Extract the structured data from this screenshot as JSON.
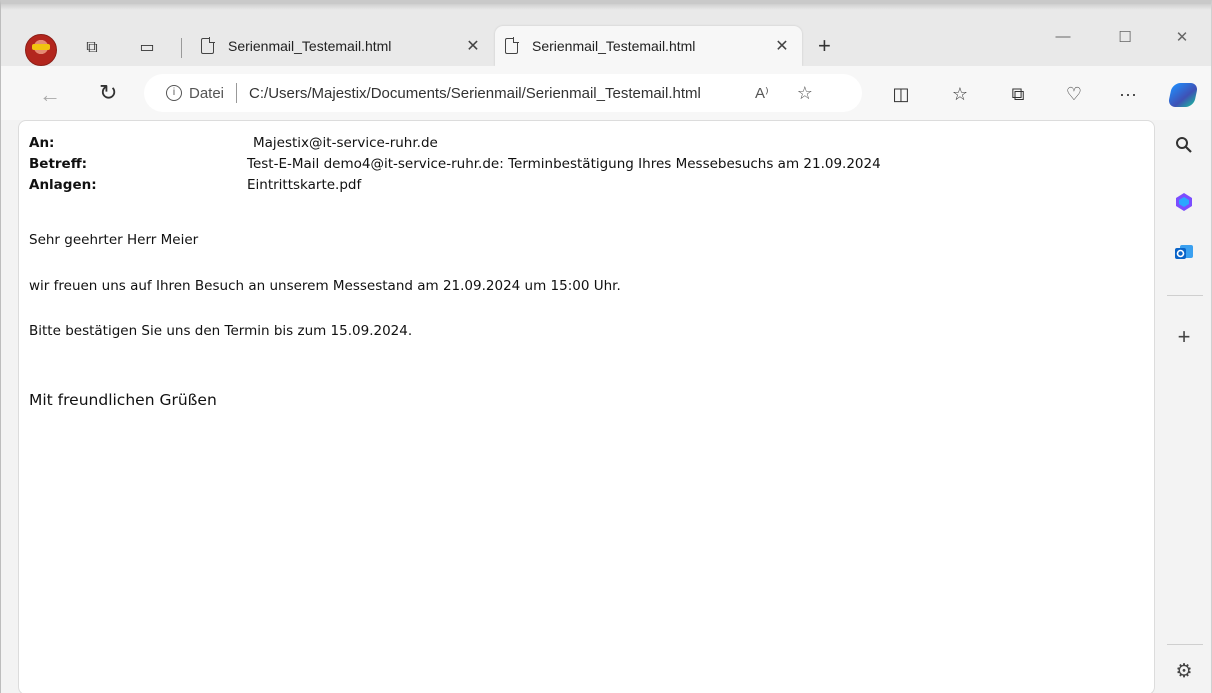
{
  "browser": {
    "tabs": [
      {
        "title": "Serienmail_Testemail.html",
        "close": "✕"
      },
      {
        "title": "Serienmail_Testemail.html",
        "close": "✕"
      }
    ],
    "new_tab": "+",
    "window_controls": {
      "minimize": "—",
      "maximize": "☐",
      "close": "✕"
    },
    "address": {
      "info": "i",
      "scheme_label": "Datei",
      "url": "C:/Users/Majestix/Documents/Serienmail/Serienmail_Testemail.html"
    },
    "more": "···"
  },
  "icons": {
    "back": "back-arrow-icon",
    "reload": "reload-icon",
    "read_aloud": "read-aloud-icon",
    "favorite": "star-icon",
    "split_screen": "split-screen-icon",
    "favorites": "favorites-icon",
    "collections": "collections-icon",
    "health": "browser-essentials-icon",
    "more": "more-icon",
    "copilot": "copilot-icon"
  },
  "email": {
    "to_label": "An:",
    "to_value": "Majestix@it-service-ruhr.de",
    "subject_label": "Betreff:",
    "subject_value": "Test-E-Mail demo4@it-service-ruhr.de: Terminbestätigung Ihres Messebesuchs am 21.09.2024",
    "attachments_label": "Anlagen:",
    "attachments_value": "Eintrittskarte.pdf",
    "greeting": "Sehr geehrter Herr Meier",
    "paragraph1": "wir freuen uns auf Ihren Besuch an unserem Messestand am 21.09.2024 um 15:00 Uhr.",
    "paragraph2": "Bitte bestätigen Sie uns den Termin bis zum 15.09.2024.",
    "closing": "Mit freundlichen Grüßen"
  },
  "sidebar": {
    "items": [
      "search-icon",
      "copilot-app-icon",
      "outlook-icon",
      "add-icon",
      "settings-icon"
    ],
    "add": "+",
    "settings": "⚙"
  },
  "colors": {
    "outlook_blue": "#0a64c8",
    "accent": "#1e90ff"
  }
}
